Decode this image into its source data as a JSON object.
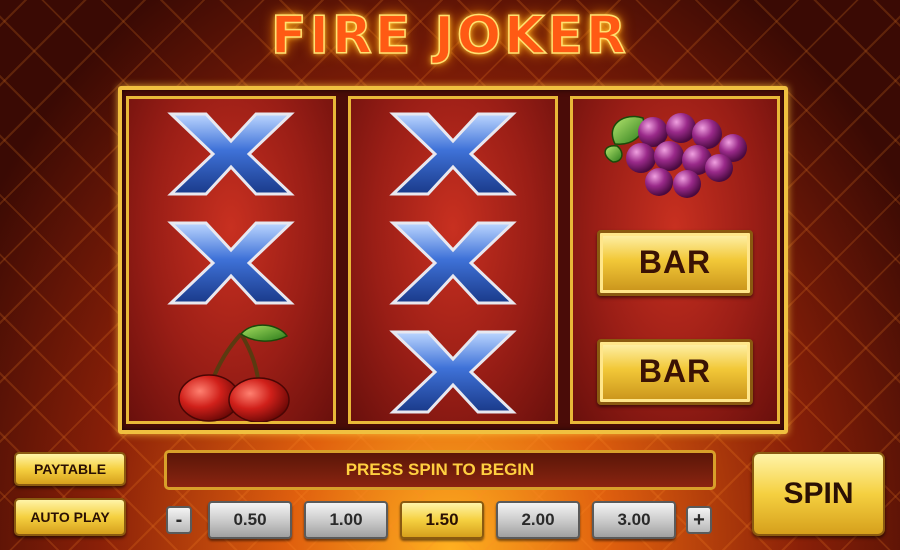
{
  "game": {
    "title": "FIRE JOKER"
  },
  "reels": [
    {
      "symbols": [
        "x-symbol",
        "x-symbol",
        "cherry-symbol"
      ]
    },
    {
      "symbols": [
        "x-symbol",
        "x-symbol",
        "x-symbol"
      ]
    },
    {
      "symbols": [
        "grapes-symbol",
        "bar-symbol",
        "bar-symbol"
      ]
    }
  ],
  "bar_label": "BAR",
  "controls": {
    "paytable_label": "PAYTABLE",
    "autoplay_label": "AUTO PLAY",
    "message": "PRESS SPIN TO BEGIN",
    "spin_label": "SPIN",
    "decrease_label": "-",
    "increase_label": "+",
    "stakes": [
      "0.50",
      "1.00",
      "1.50",
      "2.00",
      "3.00"
    ],
    "selected_stake": "1.50"
  },
  "colors": {
    "frame_gold": "#f0c040",
    "reel_red": "#9a1e16",
    "x_blue": "#2a5cc8",
    "title_orange": "#ff5a14"
  }
}
